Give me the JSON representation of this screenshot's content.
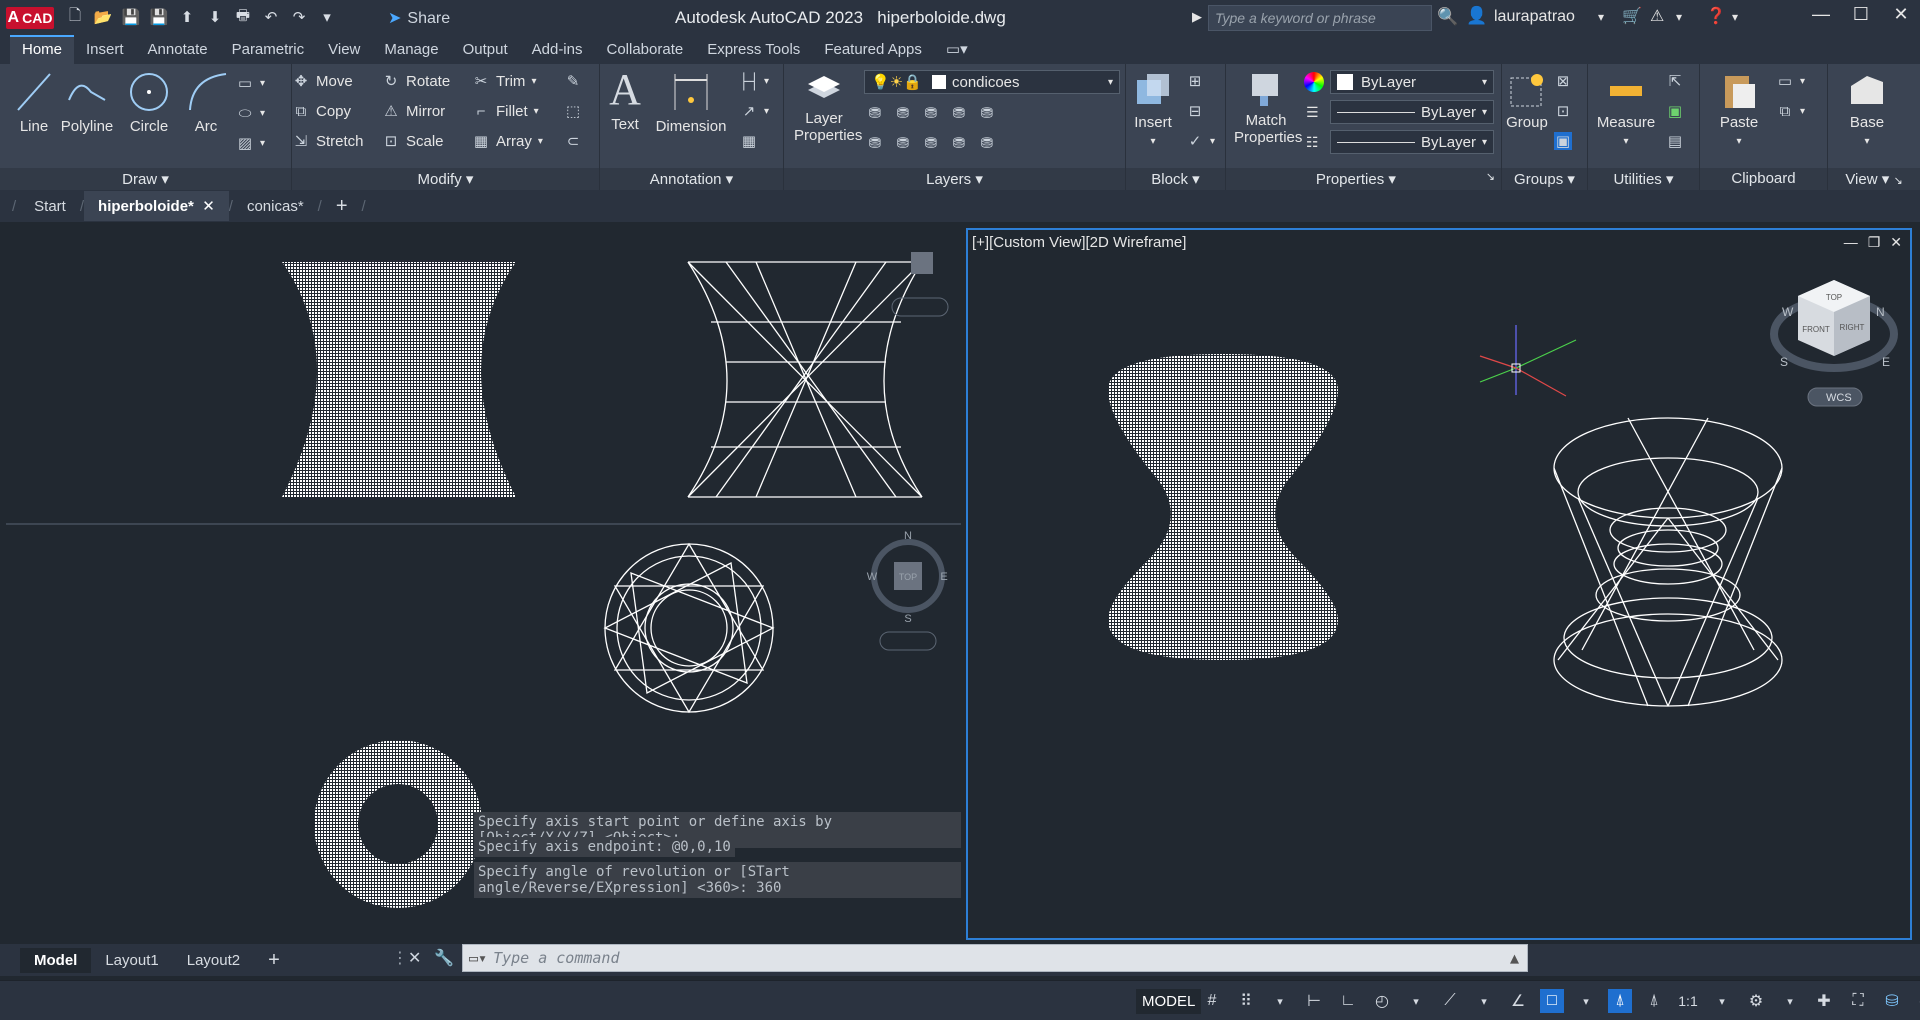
{
  "app": {
    "logo_text": "CAD",
    "title": "Autodesk AutoCAD 2023",
    "file": "hiperboloide.dwg",
    "share": "Share"
  },
  "search": {
    "placeholder": "Type a keyword or phrase"
  },
  "user": {
    "name": "laurapatrao"
  },
  "ribbon_tabs": [
    "Home",
    "Insert",
    "Annotate",
    "Parametric",
    "View",
    "Manage",
    "Output",
    "Add-ins",
    "Collaborate",
    "Express Tools",
    "Featured Apps"
  ],
  "draw": {
    "title": "Draw",
    "line": "Line",
    "polyline": "Polyline",
    "circle": "Circle",
    "arc": "Arc"
  },
  "modify": {
    "title": "Modify",
    "move": "Move",
    "rotate": "Rotate",
    "trim": "Trim",
    "copy": "Copy",
    "mirror": "Mirror",
    "fillet": "Fillet",
    "stretch": "Stretch",
    "scale": "Scale",
    "array": "Array"
  },
  "annotation": {
    "title": "Annotation",
    "text": "Text",
    "dimension": "Dimension"
  },
  "layers": {
    "title": "Layers",
    "layer_props_1": "Layer",
    "layer_props_2": "Properties",
    "current": "condicoes"
  },
  "block": {
    "title": "Block",
    "insert": "Insert"
  },
  "properties": {
    "title": "Properties",
    "match_1": "Match",
    "match_2": "Properties",
    "color": "ByLayer",
    "linetype": "ByLayer",
    "lineweight": "ByLayer"
  },
  "groups": {
    "title": "Groups",
    "group": "Group"
  },
  "utilities": {
    "title": "Utilities",
    "measure": "Measure"
  },
  "clipboard": {
    "title": "Clipboard",
    "paste": "Paste"
  },
  "view": {
    "title": "View",
    "base": "Base"
  },
  "doc_tabs": {
    "start": "Start",
    "active": "hiperboloide*",
    "other": "conicas*"
  },
  "viewport_right": {
    "label": "[+][Custom View][2D Wireframe]"
  },
  "viewcube": {
    "wcs": "WCS",
    "top": "TOP",
    "front": "FRONT",
    "right": "RIGHT",
    "s": "S",
    "e": "E",
    "n": "N",
    "w": "W"
  },
  "compass": {
    "n": "N",
    "s": "S",
    "w": "W",
    "e": "E",
    "top": "TOP"
  },
  "command_history": [
    "Specify axis start point or define axis by [Object/X/Y/Z] <Object>:",
    "Specify axis endpoint: @0,0,10",
    "Specify angle of revolution or [STart angle/Reverse/EXpression] <360>: 360"
  ],
  "command_line": {
    "placeholder": "Type a command"
  },
  "layout_tabs": {
    "model": "Model",
    "layout1": "Layout1",
    "layout2": "Layout2"
  },
  "status": {
    "model": "MODEL",
    "scale": "1:1"
  }
}
